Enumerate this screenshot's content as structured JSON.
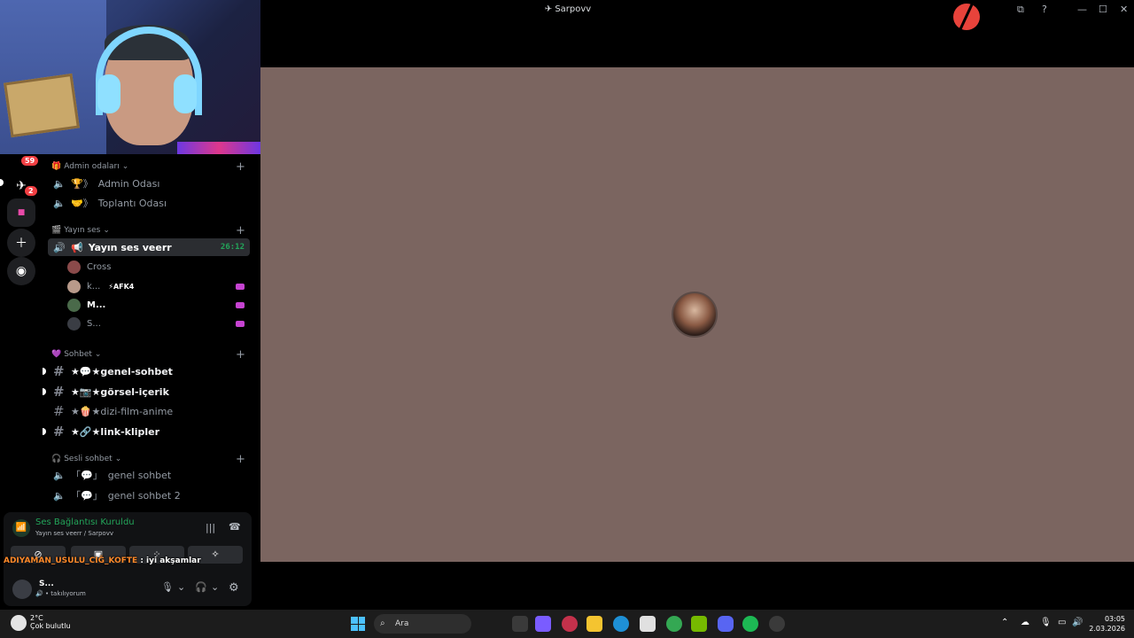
{
  "window": {
    "title": "Sarpovv"
  },
  "rail": {
    "badges": [
      "59",
      "2"
    ]
  },
  "categories": {
    "admin": "Admin odaları",
    "yayin": "Yayın ses",
    "sohbet": "Sohbet",
    "sesli": "Sesli sohbet"
  },
  "channels": {
    "admin_odasi": "Admin Odası",
    "toplanti": "Toplantı Odası",
    "yayin_ses": "Yayın ses veerr",
    "yayin_time": "26:12",
    "genel_sohbet": "★💬★genel-sohbet",
    "gorsel": "★📷★görsel-içerik",
    "dizi": "★🍿★dizi-film-anime",
    "link": "★🔗★link-klipler",
    "ses1": "genel sohbet",
    "ses2": "genel sohbet 2"
  },
  "voice_users": [
    "Cross",
    "k...",
    "M...",
    "S..."
  ],
  "afk_tag": "⚡AFK4",
  "voice_panel": {
    "status": "Ses Bağlantısı Kuruldu",
    "sub": "Yayın ses veerr / Sarpovv"
  },
  "chat_overlay": {
    "user": "ADIYAMAN_USULU_CIĞ_KOFTE",
    "message": " : iyi akşamlar"
  },
  "me": {
    "name": "S...",
    "status": "takılıyorum"
  },
  "taskbar": {
    "temp": "2°C",
    "weather": "Çok bulutlu",
    "search": "Ara",
    "time": "03:05",
    "date": "2.03.2026"
  }
}
